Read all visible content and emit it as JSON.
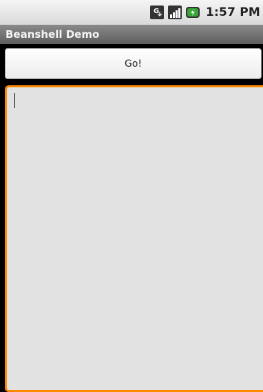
{
  "status_bar": {
    "time": "1:57 PM",
    "icons": [
      "network-type-icon",
      "signal-strength-icon",
      "battery-icon"
    ]
  },
  "title_bar": {
    "title": "Beanshell Demo"
  },
  "main": {
    "go_button_label": "Go!",
    "editor_value": ""
  },
  "colors": {
    "focus_border": "#ff8a00",
    "editor_background": "#e2e2e2",
    "title_bar": "#6f6f6f"
  }
}
